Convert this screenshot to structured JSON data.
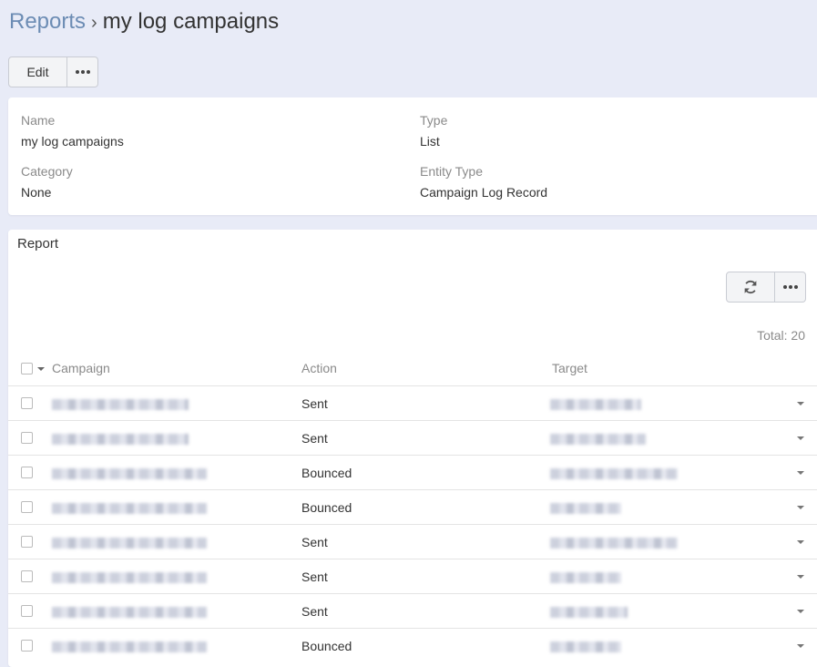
{
  "breadcrumb": {
    "parent": "Reports",
    "separator": "›",
    "current": "my log campaigns"
  },
  "actions": {
    "edit_label": "Edit",
    "more_icon": "ellipsis-icon"
  },
  "details": {
    "name_label": "Name",
    "name_value": "my log campaigns",
    "type_label": "Type",
    "type_value": "List",
    "category_label": "Category",
    "category_value": "None",
    "entity_label": "Entity Type",
    "entity_value": "Campaign Log Record"
  },
  "report": {
    "title": "Report",
    "refresh_icon": "refresh-icon",
    "total_text": "Total: 20",
    "columns": [
      "Campaign",
      "Action",
      "Target"
    ],
    "rows": [
      {
        "action": "Sent"
      },
      {
        "action": "Sent"
      },
      {
        "action": "Bounced"
      },
      {
        "action": "Bounced"
      },
      {
        "action": "Sent"
      },
      {
        "action": "Sent"
      },
      {
        "action": "Sent"
      },
      {
        "action": "Bounced"
      }
    ]
  },
  "colors": {
    "background": "#e8ebf7",
    "link": "#6c8cb4",
    "panel": "#ffffff",
    "muted_text": "#8a8a8a"
  }
}
